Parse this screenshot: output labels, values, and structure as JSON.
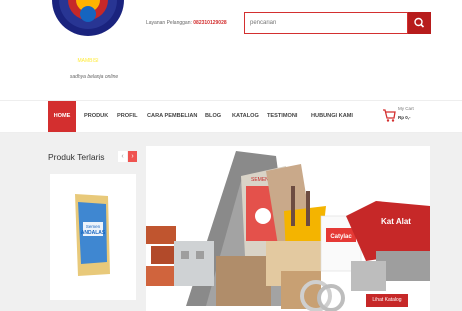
{
  "header": {
    "logo_text": "MAMBISI",
    "tagline": "sadhya belanja online",
    "contact_label": "Layanan Pelanggan:",
    "contact_phone": "082310129028"
  },
  "search": {
    "placeholder": "pencarian"
  },
  "nav": {
    "items": [
      {
        "label": "HOME"
      },
      {
        "label": "PRODUK"
      },
      {
        "label": "PROFIL"
      },
      {
        "label": "CARA PEMBELIAN"
      },
      {
        "label": "BLOG"
      },
      {
        "label": "KATALOG"
      },
      {
        "label": "TESTIMONI"
      },
      {
        "label": "HUBUNGI KAMI"
      }
    ]
  },
  "cart": {
    "label": "My Cart",
    "total": "Rp 0,-"
  },
  "sidebar": {
    "title": "Produk Terlaris",
    "prev_symbol": "‹",
    "next_symbol": "›"
  },
  "product": {
    "brand": "Semen",
    "name": "ANDALAS"
  },
  "banner": {
    "bag_label": "SEMEN",
    "paint_label": "Catylac",
    "sign_label": "Kat Alat",
    "button_label": "Lihat Katalog"
  },
  "colors": {
    "accent": "#d32f2f",
    "accent_dark": "#b71c1c",
    "background": "#f0f0f0"
  },
  "icons": {
    "search": "magnifier-icon",
    "cart": "shopping-cart-icon"
  }
}
